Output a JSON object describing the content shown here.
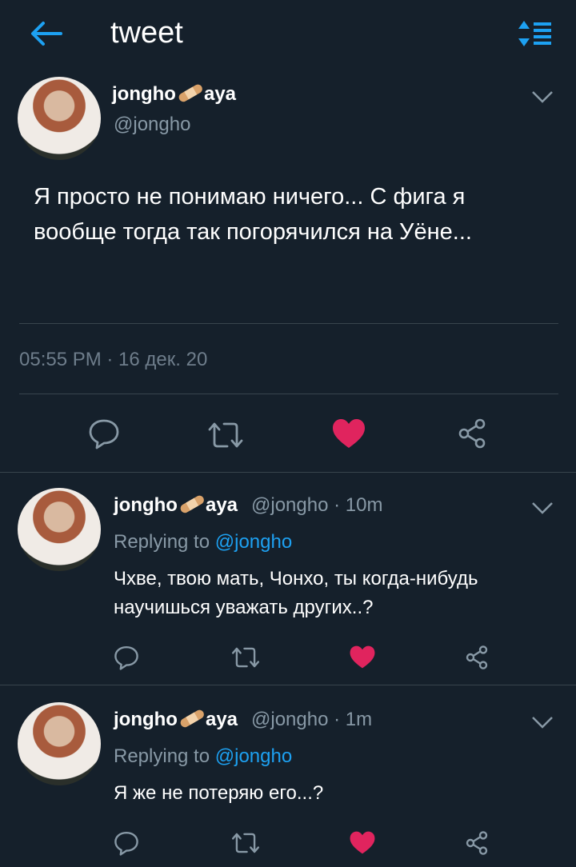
{
  "header": {
    "title": "tweet"
  },
  "main_tweet": {
    "display_name_prefix": "jongho",
    "display_name_suffix": "aya",
    "handle": "@jongho",
    "text": "Я просто не понимаю ничего... С фига я вообще тогда так погорячился на Уёне...",
    "timestamp": "05:55 PM · 16 дек. 20"
  },
  "replies": [
    {
      "display_name_prefix": "jongho",
      "display_name_suffix": "aya",
      "meta": "@jongho · 10m",
      "replying_prefix": "Replying to ",
      "replying_to": "@jongho",
      "text": "Чхве, твою мать, Чонхо, ты когда-нибудь научишься уважать других..?"
    },
    {
      "display_name_prefix": "jongho",
      "display_name_suffix": "aya",
      "meta": "@jongho · 1m",
      "replying_prefix": "Replying to ",
      "replying_to": "@jongho",
      "text": "Я же не потеряю его...?"
    }
  ],
  "icons": [
    "back-arrow-icon",
    "sort-icon",
    "chevron-down-icon",
    "reply-icon",
    "retweet-icon",
    "heart-icon",
    "share-icon",
    "bandage-emoji"
  ],
  "colors": {
    "background": "#15202b",
    "accent": "#1da1f2",
    "like": "#e0245e",
    "muted": "#8899a6",
    "divider": "#38444d"
  }
}
